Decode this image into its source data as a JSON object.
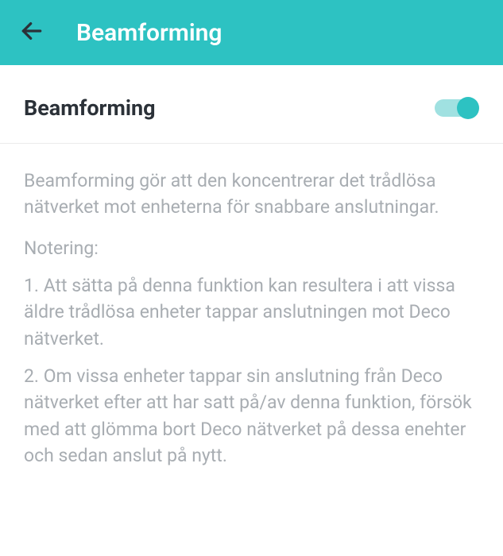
{
  "header": {
    "title": "Beamforming"
  },
  "setting": {
    "label": "Beamforming",
    "enabled": true
  },
  "description": {
    "main": "Beamforming gör att den koncentrerar det trådlösa nätverket mot enheterna för snabbare anslutningar.",
    "note_label": "Notering:",
    "notes": [
      "1. Att sätta på denna funktion kan resultera i att vissa äldre trådlösa enheter tappar anslutningen mot Deco nätverket.",
      "2. Om vissa enheter tappar sin anslutning från Deco nätverket efter att har satt på/av denna funktion, försök med att glömma bort Deco nätverket på dessa enehter och sedan anslut på nytt."
    ]
  }
}
